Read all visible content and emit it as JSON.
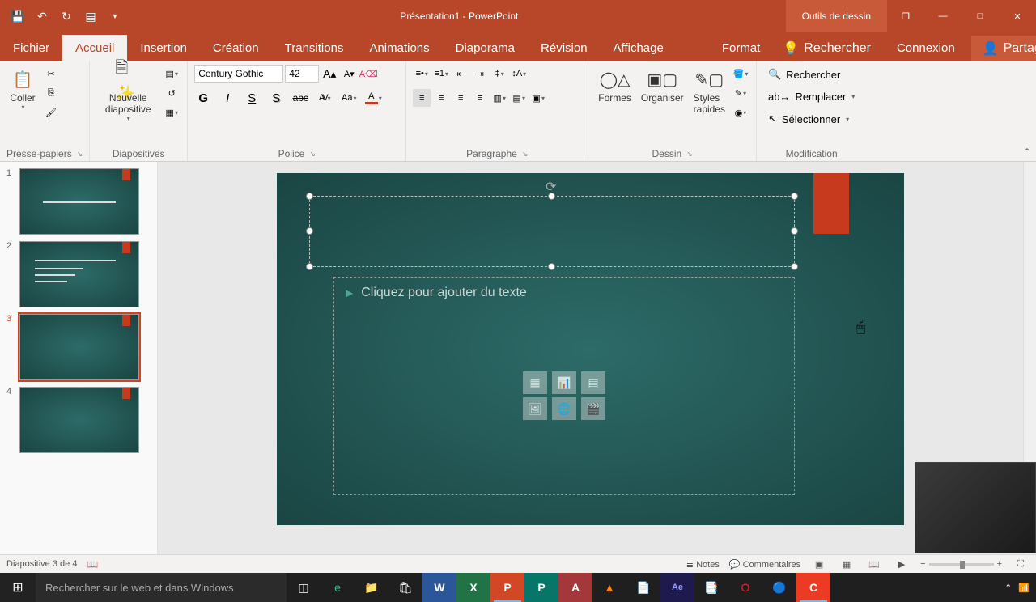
{
  "titlebar": {
    "document_title": "Présentation1 - PowerPoint",
    "contextual_tab": "Outils de dessin",
    "window_controls": {
      "restore": "❐",
      "minimize": "—",
      "maximize": "□",
      "close": "✕"
    }
  },
  "tabs": {
    "fichier": "Fichier",
    "accueil": "Accueil",
    "insertion": "Insertion",
    "creation": "Création",
    "transitions": "Transitions",
    "animations": "Animations",
    "diaporama": "Diaporama",
    "revision": "Révision",
    "affichage": "Affichage",
    "format": "Format",
    "search_placeholder": "Rechercher",
    "connexion": "Connexion",
    "partager": "Partager"
  },
  "ribbon": {
    "clipboard": {
      "paste": "Coller",
      "label": "Presse-papiers"
    },
    "slides": {
      "new_slide": "Nouvelle diapositive",
      "label": "Diapositives"
    },
    "font": {
      "family": "Century Gothic",
      "size": "42",
      "bold": "G",
      "italic": "I",
      "underline": "S",
      "shadow": "S",
      "strikethrough": "abc",
      "spacing": "AV",
      "case": "Aa",
      "color": "A",
      "label": "Police"
    },
    "paragraph": {
      "label": "Paragraphe"
    },
    "drawing": {
      "shapes": "Formes",
      "arrange": "Organiser",
      "styles_line1": "Styles",
      "styles_line2": "rapides",
      "label": "Dessin"
    },
    "editing": {
      "find": "Rechercher",
      "replace": "Remplacer",
      "select": "Sélectionner",
      "label": "Modification"
    }
  },
  "thumbs": {
    "slide1": {
      "text": "Bonjour chers collègues"
    },
    "count": 4,
    "selected": 3
  },
  "slide": {
    "content_placeholder": "Cliquez pour ajouter du texte"
  },
  "statusbar": {
    "slide_indicator": "Diapositive 3 de 4",
    "notes": "Notes",
    "comments": "Commentaires"
  },
  "taskbar": {
    "search_placeholder": "Rechercher sur le web et dans Windows"
  }
}
